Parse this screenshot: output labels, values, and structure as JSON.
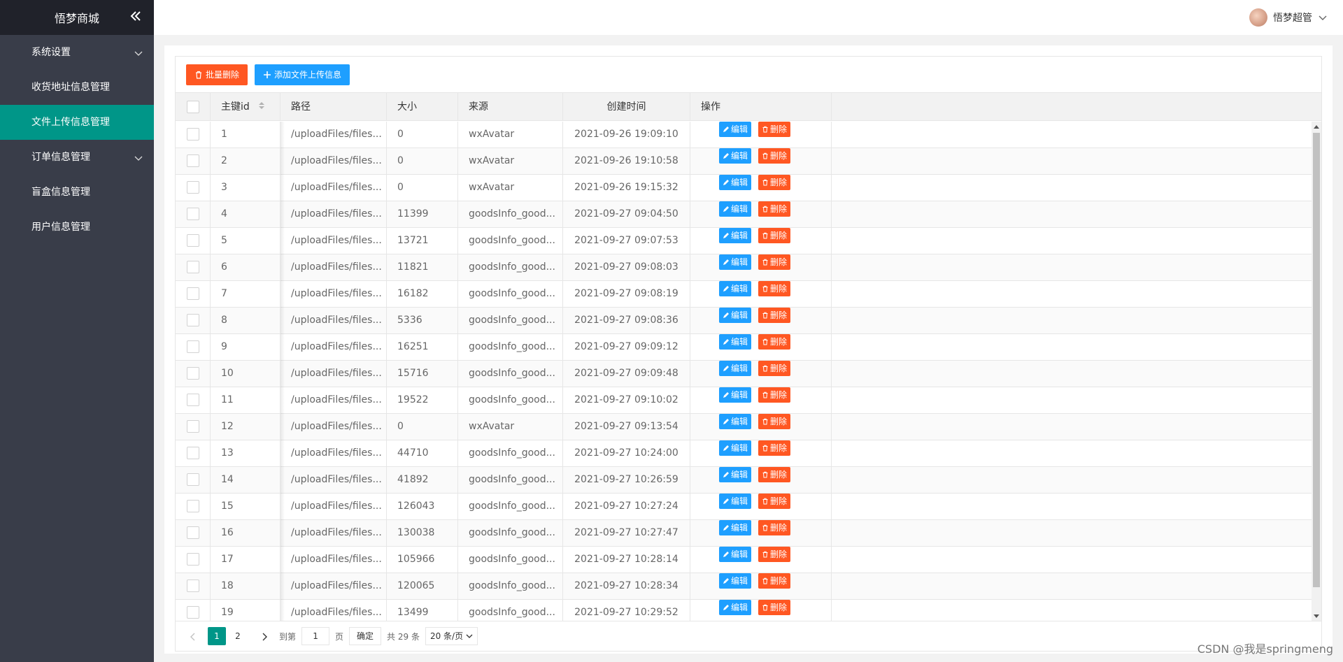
{
  "sidebar": {
    "logo": "悟梦商城",
    "collapse_icon": "double-chevron-left-icon",
    "items": [
      {
        "label": "系统设置",
        "has_children": true
      },
      {
        "label": "收货地址信息管理",
        "has_children": false
      },
      {
        "label": "文件上传信息管理",
        "has_children": false,
        "active": true
      },
      {
        "label": "订单信息管理",
        "has_children": true
      },
      {
        "label": "盲盒信息管理",
        "has_children": false
      },
      {
        "label": "用户信息管理",
        "has_children": false
      }
    ]
  },
  "header": {
    "username": "悟梦超管"
  },
  "toolbar": {
    "batch_delete": "批量删除",
    "add_file": "添加文件上传信息"
  },
  "table": {
    "headers": {
      "id": "主键id",
      "path": "路径",
      "size": "大小",
      "source": "来源",
      "created": "创建时间",
      "ops": "操作"
    },
    "edit_label": "编辑",
    "delete_label": "删除",
    "rows": [
      {
        "id": "1",
        "path": "/uploadFiles/files...",
        "size": "0",
        "source": "wxAvatar",
        "created": "2021-09-26 19:09:10"
      },
      {
        "id": "2",
        "path": "/uploadFiles/files...",
        "size": "0",
        "source": "wxAvatar",
        "created": "2021-09-26 19:10:58"
      },
      {
        "id": "3",
        "path": "/uploadFiles/files...",
        "size": "0",
        "source": "wxAvatar",
        "created": "2021-09-26 19:15:32"
      },
      {
        "id": "4",
        "path": "/uploadFiles/files...",
        "size": "11399",
        "source": "goodsInfo_good...",
        "created": "2021-09-27 09:04:50"
      },
      {
        "id": "5",
        "path": "/uploadFiles/files...",
        "size": "13721",
        "source": "goodsInfo_good...",
        "created": "2021-09-27 09:07:53"
      },
      {
        "id": "6",
        "path": "/uploadFiles/files...",
        "size": "11821",
        "source": "goodsInfo_good...",
        "created": "2021-09-27 09:08:03"
      },
      {
        "id": "7",
        "path": "/uploadFiles/files...",
        "size": "16182",
        "source": "goodsInfo_good...",
        "created": "2021-09-27 09:08:19"
      },
      {
        "id": "8",
        "path": "/uploadFiles/files...",
        "size": "5336",
        "source": "goodsInfo_good...",
        "created": "2021-09-27 09:08:36"
      },
      {
        "id": "9",
        "path": "/uploadFiles/files...",
        "size": "16251",
        "source": "goodsInfo_good...",
        "created": "2021-09-27 09:09:12"
      },
      {
        "id": "10",
        "path": "/uploadFiles/files...",
        "size": "15716",
        "source": "goodsInfo_good...",
        "created": "2021-09-27 09:09:48"
      },
      {
        "id": "11",
        "path": "/uploadFiles/files...",
        "size": "19522",
        "source": "goodsInfo_good...",
        "created": "2021-09-27 09:10:02"
      },
      {
        "id": "12",
        "path": "/uploadFiles/files...",
        "size": "0",
        "source": "wxAvatar",
        "created": "2021-09-27 09:13:54"
      },
      {
        "id": "13",
        "path": "/uploadFiles/files...",
        "size": "44710",
        "source": "goodsInfo_good...",
        "created": "2021-09-27 10:24:00"
      },
      {
        "id": "14",
        "path": "/uploadFiles/files...",
        "size": "41892",
        "source": "goodsInfo_good...",
        "created": "2021-09-27 10:26:59"
      },
      {
        "id": "15",
        "path": "/uploadFiles/files...",
        "size": "126043",
        "source": "goodsInfo_good...",
        "created": "2021-09-27 10:27:24"
      },
      {
        "id": "16",
        "path": "/uploadFiles/files...",
        "size": "130038",
        "source": "goodsInfo_good...",
        "created": "2021-09-27 10:27:47"
      },
      {
        "id": "17",
        "path": "/uploadFiles/files...",
        "size": "105966",
        "source": "goodsInfo_good...",
        "created": "2021-09-27 10:28:14"
      },
      {
        "id": "18",
        "path": "/uploadFiles/files...",
        "size": "120065",
        "source": "goodsInfo_good...",
        "created": "2021-09-27 10:28:34"
      },
      {
        "id": "19",
        "path": "/uploadFiles/files...",
        "size": "13499",
        "source": "goodsInfo_good...",
        "created": "2021-09-27 10:29:52"
      }
    ]
  },
  "pagination": {
    "pages": [
      "1",
      "2"
    ],
    "current": "1",
    "goto_label": "到第",
    "goto_value": "1",
    "page_unit": "页",
    "confirm": "确定",
    "total": "共 29 条",
    "page_size": "20 条/页"
  },
  "watermark": "CSDN @我是springmeng",
  "colors": {
    "sidebar_bg": "#393d49",
    "active_green": "#009688",
    "btn_blue": "#1e9fff",
    "btn_orange": "#ff5722"
  }
}
